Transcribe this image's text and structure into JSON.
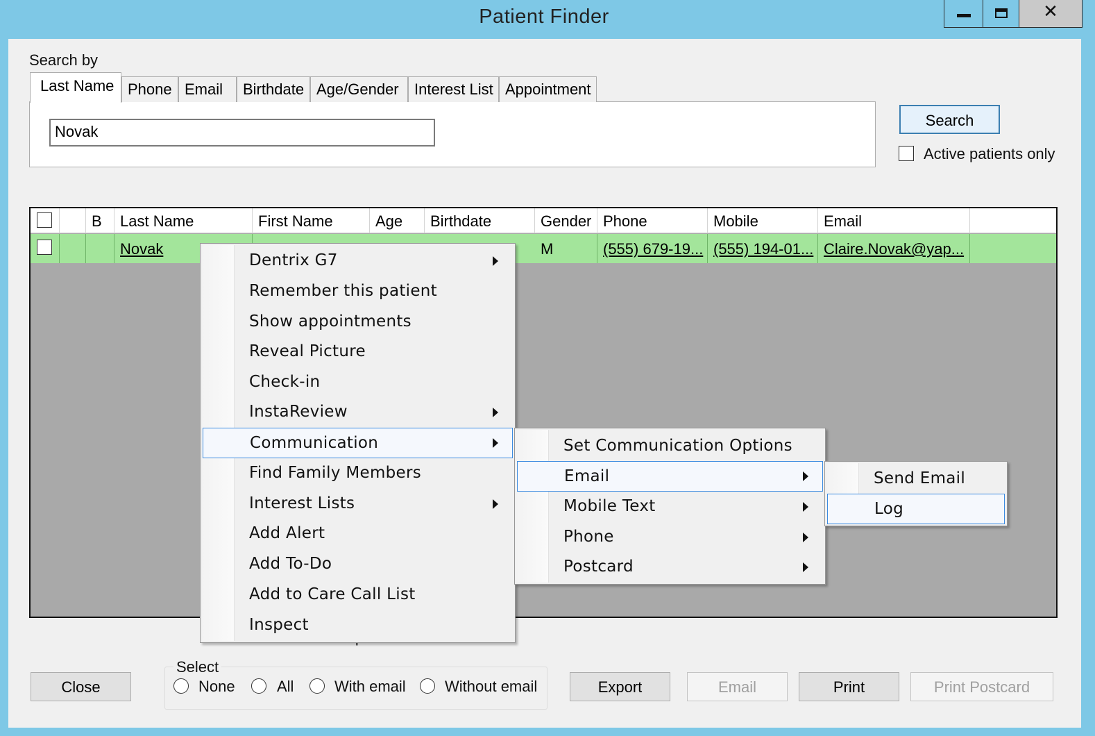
{
  "window": {
    "title": "Patient Finder"
  },
  "search": {
    "search_by_label": "Search by",
    "tabs": [
      "Last Name",
      "Phone",
      "Email",
      "Birthdate",
      "Age/Gender",
      "Interest List",
      "Appointment"
    ],
    "active_tab": "Last Name",
    "value": "Novak",
    "search_button": "Search",
    "active_only_label": "Active patients only",
    "active_only_checked": false
  },
  "grid": {
    "columns": [
      "B",
      "Last Name",
      "First Name",
      "Age",
      "Birthdate",
      "Gender",
      "Phone",
      "Mobile",
      "Email"
    ],
    "row": {
      "last_name": "Novak",
      "gender": "M",
      "phone": "(555) 679-19...",
      "mobile": "(555) 194-01...",
      "email": "Claire.Novak@yap..."
    },
    "row_color": "#a3e59b",
    "found_text": "Found 1 patient"
  },
  "context_menu": {
    "items": [
      {
        "label": "Dentrix G7",
        "submenu": true
      },
      {
        "label": "Remember this patient",
        "submenu": false
      },
      {
        "label": "Show appointments",
        "submenu": false
      },
      {
        "label": "Reveal Picture",
        "submenu": false
      },
      {
        "label": "Check-in",
        "submenu": false
      },
      {
        "label": "InstaReview",
        "submenu": true
      },
      {
        "label": "Communication",
        "submenu": true,
        "highlighted": true
      },
      {
        "label": "Find Family Members",
        "submenu": false
      },
      {
        "label": "Interest Lists",
        "submenu": true
      },
      {
        "label": "Add Alert",
        "submenu": false
      },
      {
        "label": "Add To-Do",
        "submenu": false
      },
      {
        "label": "Add to Care Call List",
        "submenu": false
      },
      {
        "label": "Inspect",
        "submenu": false
      }
    ]
  },
  "communication_menu": {
    "items": [
      {
        "label": "Set Communication Options",
        "submenu": false
      },
      {
        "label": "Email",
        "submenu": true,
        "highlighted": true
      },
      {
        "label": "Mobile Text",
        "submenu": true
      },
      {
        "label": "Phone",
        "submenu": true
      },
      {
        "label": "Postcard",
        "submenu": true
      }
    ]
  },
  "email_menu": {
    "items": [
      {
        "label": "Send Email"
      },
      {
        "label": "Log",
        "highlighted": true
      }
    ]
  },
  "footer": {
    "close": "Close",
    "select_label": "Select",
    "select_options": [
      "None",
      "All",
      "With email",
      "Without email"
    ],
    "export": "Export",
    "email": "Email",
    "print": "Print",
    "print_postcard": "Print Postcard"
  }
}
